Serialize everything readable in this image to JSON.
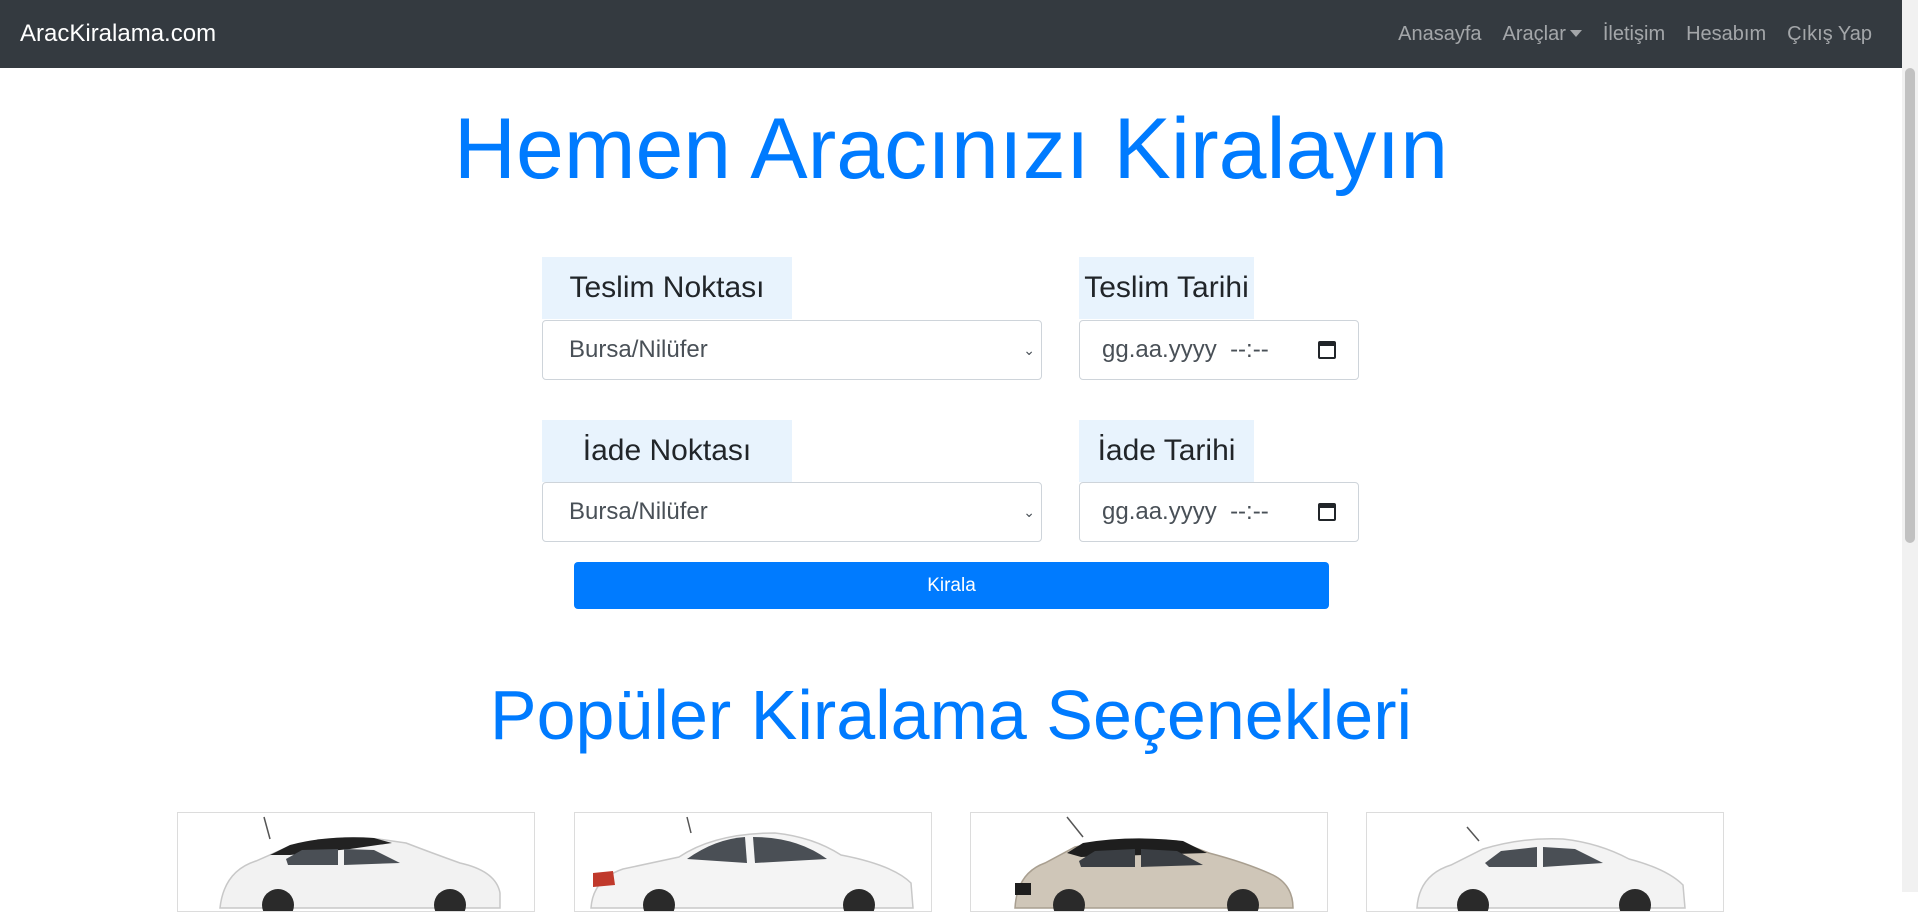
{
  "navbar": {
    "brand": "AracKiralama.com",
    "links": [
      "Anasayfa",
      "Araçlar",
      "İletişim",
      "Hesabım",
      "Çıkış Yap"
    ]
  },
  "hero": {
    "title": "Hemen Aracınızı Kiralayın"
  },
  "form": {
    "pickup_location_label": "Teslim Noktası",
    "pickup_location_value": "Bursa/Nilüfer",
    "pickup_date_label": "Teslim Tarihi",
    "pickup_date_placeholder": "gg.aa.yyyy  --:--",
    "return_location_label": "İade Noktası",
    "return_location_value": "Bursa/Nilüfer",
    "return_date_label": "İade Tarihi",
    "return_date_placeholder": "gg.aa.yyyy  --:--",
    "submit_label": "Kirala"
  },
  "popular": {
    "title": "Popüler Kiralama Seçenekleri",
    "cars": [
      {
        "icon": "car-image-suv-white",
        "color": "#f2f2f2",
        "roof": "#222222"
      },
      {
        "icon": "car-image-sedan-white",
        "color": "#f4f4f4",
        "roof": "#f4f4f4"
      },
      {
        "icon": "car-image-crossover-beige",
        "color": "#cfc6b8",
        "roof": "#1e1e1e"
      },
      {
        "icon": "car-image-hatchback-white",
        "color": "#f3f3f3",
        "roof": "#f3f3f3"
      }
    ]
  },
  "colors": {
    "navbar": "#343a40",
    "accent": "#007bff",
    "label_bg": "#e8f3fd"
  }
}
